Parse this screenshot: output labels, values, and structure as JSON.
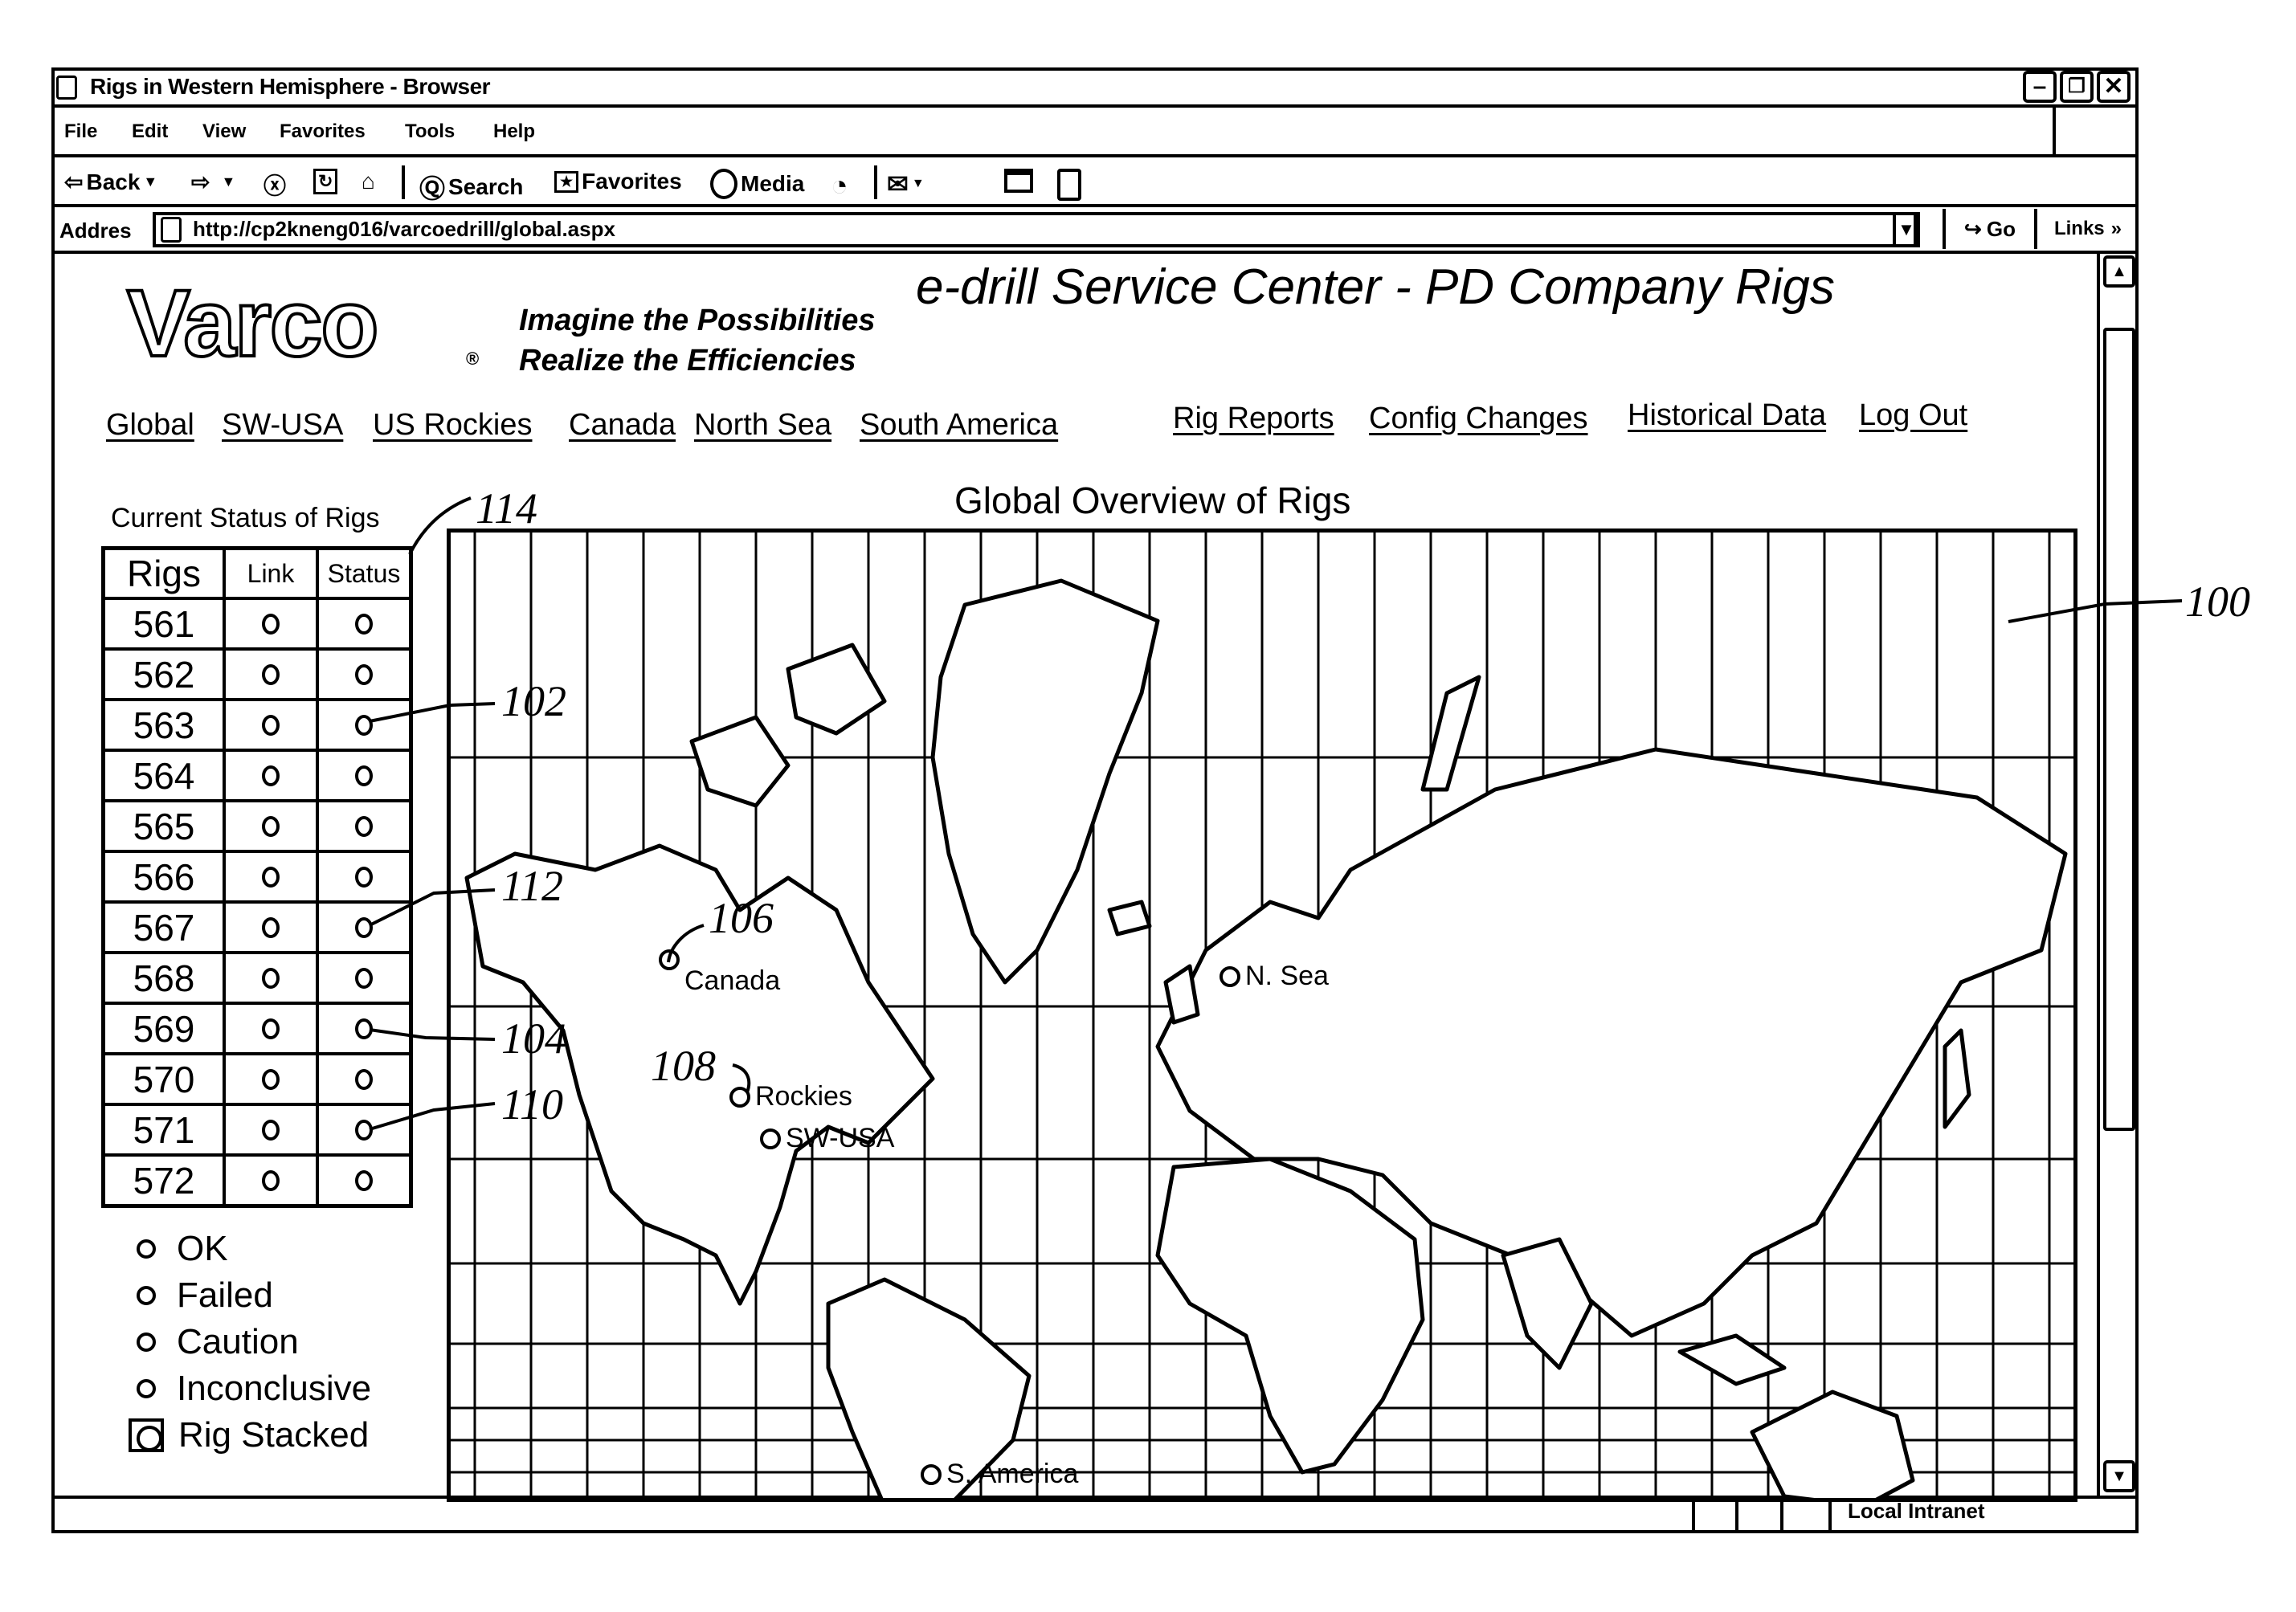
{
  "window": {
    "title": "Rigs in Western Hemisphere - Browser",
    "controls": {
      "minimize": "–",
      "restore": "❐",
      "close": "✕"
    }
  },
  "menu": [
    "File",
    "Edit",
    "View",
    "Favorites",
    "Tools",
    "Help"
  ],
  "toolbar": {
    "back": "Back",
    "search": "Search",
    "favorites": "Favorites",
    "media": "Media"
  },
  "address": {
    "label": "Addres",
    "url": "http://cp2kneng016/varcoedrill/global.aspx",
    "go": "Go",
    "links": "Links",
    "links_chevron": "»"
  },
  "header": {
    "logo": "Varco",
    "registered": "®",
    "tagline_1": "Imagine the Possibilities",
    "tagline_2": "Realize the Efficiencies",
    "title": "e-drill Service Center - PD Company Rigs"
  },
  "nav": {
    "regions": [
      "Global",
      "SW-USA",
      "US Rockies",
      "Canada",
      "North Sea",
      "South America"
    ],
    "actions": [
      "Rig Reports",
      "Config Changes",
      "Historical Data",
      "Log Out"
    ]
  },
  "status_panel": {
    "title": "Current Status of Rigs",
    "columns": [
      "Rigs",
      "Link",
      "Status"
    ],
    "rows": [
      {
        "rig": "561",
        "link": "ok",
        "status": "ok"
      },
      {
        "rig": "562",
        "link": "ok",
        "status": "ok"
      },
      {
        "rig": "563",
        "link": "ok",
        "status": "ok"
      },
      {
        "rig": "564",
        "link": "ok",
        "status": "ok"
      },
      {
        "rig": "565",
        "link": "ok",
        "status": "ok"
      },
      {
        "rig": "566",
        "link": "ok",
        "status": "ok"
      },
      {
        "rig": "567",
        "link": "ok",
        "status": "ok"
      },
      {
        "rig": "568",
        "link": "ok",
        "status": "ok"
      },
      {
        "rig": "569",
        "link": "ok",
        "status": "ok"
      },
      {
        "rig": "570",
        "link": "ok",
        "status": "ok"
      },
      {
        "rig": "571",
        "link": "ok",
        "status": "ok"
      },
      {
        "rig": "572",
        "link": "ok",
        "status": "ok"
      }
    ]
  },
  "legend": [
    "OK",
    "Failed",
    "Caution",
    "Inconclusive",
    "Rig Stacked"
  ],
  "map": {
    "title": "Global Overview of Rigs",
    "locations": [
      "Canada",
      "Rockies",
      "SW-USA",
      "N. Sea",
      "S. America"
    ]
  },
  "reference_numerals": [
    "100",
    "102",
    "104",
    "106",
    "108",
    "110",
    "112",
    "114"
  ],
  "statusbar": {
    "zone": "Local Intranet"
  }
}
